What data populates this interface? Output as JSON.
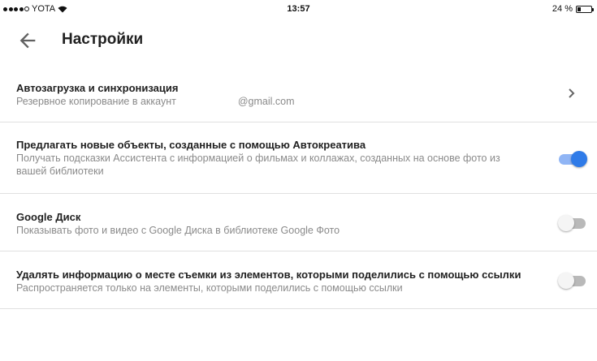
{
  "status_bar": {
    "carrier": "YOTA",
    "time": "13:57",
    "battery_text": "24 %",
    "battery_level": 0.24
  },
  "header": {
    "title": "Настройки",
    "back_icon": "arrow-back-icon"
  },
  "settings": [
    {
      "title": "Автозагрузка и синхронизация",
      "subtitle": "Резервное копирование в аккаунт",
      "account": "@gmail.com",
      "control": "chevron-right-icon"
    },
    {
      "title": "Предлагать новые объекты, созданные с помощью Автокреатива",
      "subtitle": "Получать подсказки Ассистента с информацией о фильмах и коллажах, созданных на основе фото из вашей библиотеки",
      "toggle": true
    },
    {
      "title": "Google Диск",
      "subtitle": "Показывать фото и видео с Google Диска в библиотеке Google Фото",
      "toggle": false
    },
    {
      "title": "Удалять информацию о месте съемки из элементов, которыми поделились с помощью ссылки",
      "subtitle": "Распространяется только на элементы, которыми поделились с помощью ссылки",
      "toggle": false
    }
  ],
  "colors": {
    "accent": "#2f7be8",
    "accent_track": "#90b5f5",
    "divider": "#e0e0e0",
    "secondary_text": "#8a8a8a"
  }
}
